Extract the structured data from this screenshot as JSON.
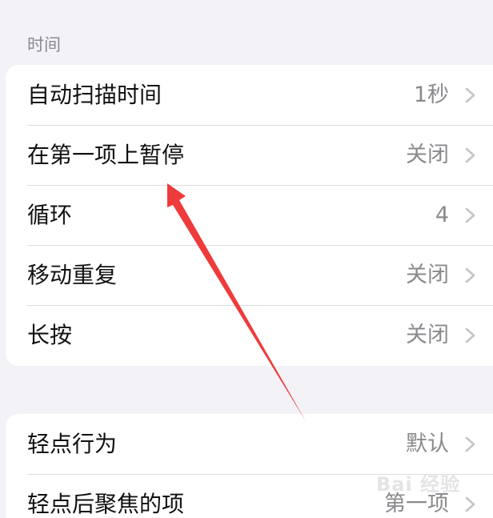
{
  "section": {
    "header": "时间"
  },
  "group1": {
    "rows": [
      {
        "label": "自动扫描时间",
        "value": "1秒"
      },
      {
        "label": "在第一项上暂停",
        "value": "关闭"
      },
      {
        "label": "循环",
        "value": "4"
      },
      {
        "label": "移动重复",
        "value": "关闭"
      },
      {
        "label": "长按",
        "value": "关闭"
      }
    ]
  },
  "group2": {
    "rows": [
      {
        "label": "轻点行为",
        "value": "默认"
      },
      {
        "label": "轻点后聚焦的项",
        "value": "第一项"
      }
    ]
  },
  "annotation": {
    "color": "#ee3b3b"
  },
  "watermark": {
    "text": "Bai 经验"
  },
  "icons": {
    "row_chevron": "chevron-right-icon",
    "annotation_arrow": "red-arrow-annotation",
    "watermark_logo": "baidu-paw-icon"
  }
}
